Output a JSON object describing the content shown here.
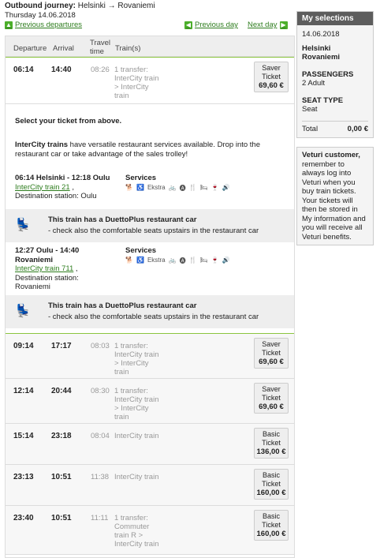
{
  "header": {
    "outbound_label": "Outbound journey:",
    "route": "Helsinki → Rovaniemi",
    "date": "Thursday 14.06.2018",
    "prev_departures": "Previous departures",
    "prev_day": "Previous day",
    "next_day": "Next day"
  },
  "columns": {
    "departure": "Departure",
    "arrival": "Arrival",
    "travel_time": "Travel time",
    "trains": "Train(s)"
  },
  "rows": [
    {
      "dep": "06:14",
      "arr": "14:40",
      "dur": "08:26",
      "desc": [
        "1 transfer:",
        "InterCity train",
        "> InterCity",
        "train"
      ],
      "ticket": [
        "Saver",
        "Ticket"
      ],
      "price": "69,60 €"
    },
    {
      "dep": "09:14",
      "arr": "17:17",
      "dur": "08:03",
      "desc": [
        "1 transfer:",
        "InterCity train",
        "> InterCity",
        "train"
      ],
      "ticket": [
        "Saver",
        "Ticket"
      ],
      "price": "69,60 €"
    },
    {
      "dep": "12:14",
      "arr": "20:44",
      "dur": "08:30",
      "desc": [
        "1 transfer:",
        "InterCity train",
        "> InterCity",
        "train"
      ],
      "ticket": [
        "Saver",
        "Ticket"
      ],
      "price": "69,60 €"
    },
    {
      "dep": "15:14",
      "arr": "23:18",
      "dur": "08:04",
      "desc": [
        "InterCity train"
      ],
      "ticket": [
        "Basic",
        "Ticket"
      ],
      "price": "136,00 €"
    },
    {
      "dep": "23:13",
      "arr": "10:51",
      "dur": "11:38",
      "desc": [
        "InterCity train"
      ],
      "ticket": [
        "Basic",
        "Ticket"
      ],
      "price": "160,00 €"
    },
    {
      "dep": "23:40",
      "arr": "10:51",
      "dur": "11:11",
      "desc": [
        "1 transfer:",
        "Commuter",
        "train R >",
        "InterCity train"
      ],
      "ticket": [
        "Basic",
        "Ticket"
      ],
      "price": "160,00 €"
    }
  ],
  "detail": {
    "select_hint": "Select your ticket from above.",
    "ic_bold": "InterCity trains",
    "ic_text": " have versatile restaurant services available. Drop into the restaurant car or take advantage of the sales trolley!",
    "seg1": {
      "line1": "06:14 Helsinki - 12:18 Oulu",
      "train": "InterCity train 21",
      "comma": " ,",
      "dest": "Destination station: Oulu"
    },
    "seg2": {
      "line1": "12:27 Oulu - ",
      "line1b": "14:40",
      "line2": "Rovaniemi",
      "train": "InterCity train 711",
      "comma": " ,",
      "dest1": "Destination station:",
      "dest2": "Rovaniemi"
    },
    "services_label": "Services",
    "services_icons": [
      "🐕",
      "♿",
      "Ekstra",
      "🚲",
      "🅐",
      "🍴",
      "🛏",
      "🍷",
      "🔊"
    ],
    "banner_title": "This train has a DuettoPlus restaurant car",
    "banner_sub": "- check also the comfortable seats upstairs in the restaurant car"
  },
  "side": {
    "title": "My selections",
    "date": "14.06.2018",
    "from": "Helsinki",
    "to": "Rovaniemi",
    "passengers_label": "PASSENGERS",
    "passengers": "2 Adult",
    "seat_label": "SEAT TYPE",
    "seat": "Seat",
    "total_label": "Total",
    "total": "0,00 €"
  },
  "side2": {
    "bold": "Veturi customer,",
    "text": "remember to always log into Veturi when you buy train tickets. Your tickets will then be stored in My information and you will receive all Veturi benefits."
  },
  "colors": {
    "accent": "#4caf2a",
    "link": "#2e7d1e",
    "selected_border": "#8bc53f"
  }
}
